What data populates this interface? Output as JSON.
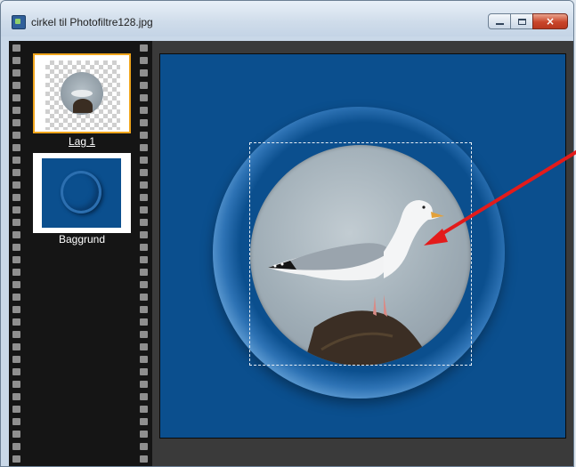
{
  "window": {
    "title": "cirkel til Photofiltre128.jpg",
    "controls": {
      "minimize": "minimize",
      "maximize": "maximize",
      "close": "×"
    }
  },
  "layers": [
    {
      "label": "Lag 1",
      "active": true
    },
    {
      "label": "Baggrund",
      "active": false
    }
  ],
  "colors": {
    "canvas_blue": "#0b4f8e",
    "active_layer_border": "#f0a51c",
    "annotation_arrow": "#e31b1b"
  },
  "icons": {
    "app": "image-file-icon",
    "minimize": "minimize-icon",
    "maximize": "maximize-icon",
    "close": "close-icon"
  }
}
